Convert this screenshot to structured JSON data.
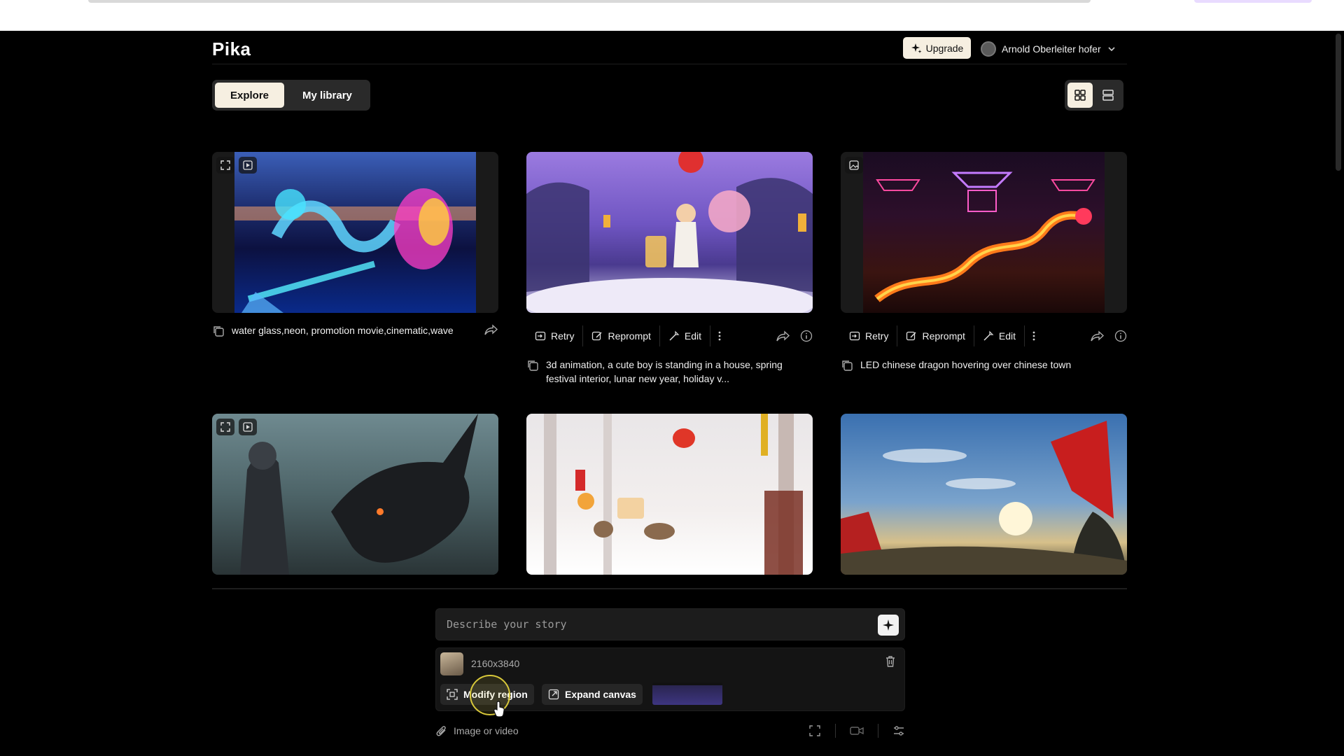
{
  "app": {
    "name": "Pika"
  },
  "header": {
    "upgrade_label": "Upgrade",
    "user_name": "Arnold Oberleiter hofer"
  },
  "tabs": [
    {
      "label": "Explore",
      "active": true
    },
    {
      "label": "My library",
      "active": false
    }
  ],
  "view_modes": [
    "grid-view-icon",
    "list-view-icon"
  ],
  "cards": [
    {
      "caption": "water glass,neon, promotion movie,cinematic,wave",
      "has_actions": false
    },
    {
      "caption": "3d animation, a cute boy is standing in a house, spring festival interior, lunar new year, holiday v...",
      "has_actions": true
    },
    {
      "caption": "LED chinese dragon hovering over chinese town",
      "has_actions": true
    },
    {
      "caption": "",
      "has_actions": false
    },
    {
      "caption": "",
      "has_actions": false
    },
    {
      "caption": "",
      "has_actions": false
    }
  ],
  "actions": {
    "retry": "Retry",
    "reprompt": "Reprompt",
    "edit": "Edit"
  },
  "composer": {
    "placeholder": "Describe your story",
    "media_size": "2160x3840",
    "modify_region": "Modify region",
    "expand_canvas": "Expand canvas",
    "attach_label": "Image or video"
  },
  "colors": {
    "background": "#000000",
    "accent_cream": "#f6efe1",
    "panel": "#1c1c1c"
  }
}
